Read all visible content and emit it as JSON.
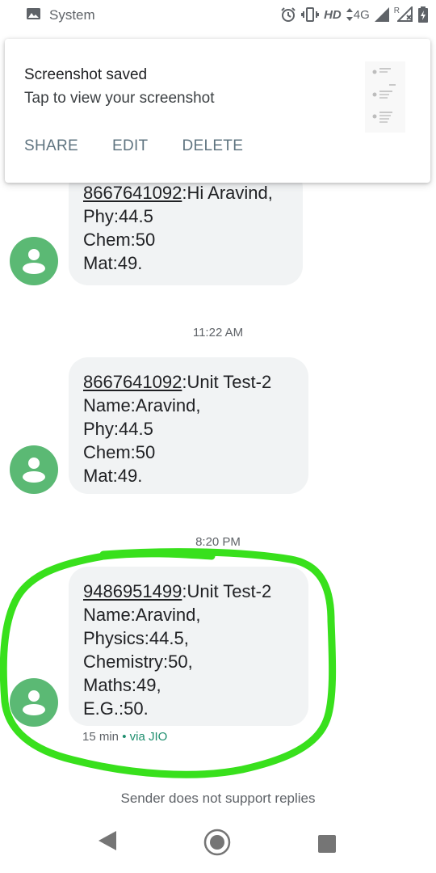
{
  "status_bar": {
    "app_name": "System",
    "network": "4G",
    "hd_label": "HD",
    "roaming": "R",
    "icons": [
      "image-icon",
      "alarm-icon",
      "vibrate-icon",
      "signal-icon",
      "roaming-signal-icon",
      "battery-icon"
    ]
  },
  "notification": {
    "title": "Screenshot saved",
    "text": "Tap to view your screenshot",
    "actions": [
      "SHARE",
      "EDIT",
      "DELETE"
    ]
  },
  "messages": [
    {
      "sender": "8667641092",
      "lines": [
        ":Hi Aravind,",
        "Phy:44.5",
        "Chem:50",
        "Mat:49."
      ]
    },
    {
      "timestamp": "11:22 AM",
      "sender": "8667641092",
      "lines": [
        ":Unit Test-2",
        "Name:Aravind,",
        "Phy:44.5",
        "Chem:50",
        "Mat:49."
      ]
    },
    {
      "timestamp": "8:20 PM",
      "sender": "9486951499",
      "lines": [
        ":Unit Test-2",
        "Name:Aravind,",
        "Physics:44.5,",
        "Chemistry:50,",
        "Maths:49,",
        "E.G.:50."
      ],
      "age": "15 min",
      "separator": "•",
      "via": "via JIO"
    }
  ],
  "footer_note": "Sender does not support replies",
  "colors": {
    "avatar": "#5bb974",
    "bubble": "#f1f3f4",
    "annotation": "#38e01c",
    "via": "#1e8e6e"
  }
}
